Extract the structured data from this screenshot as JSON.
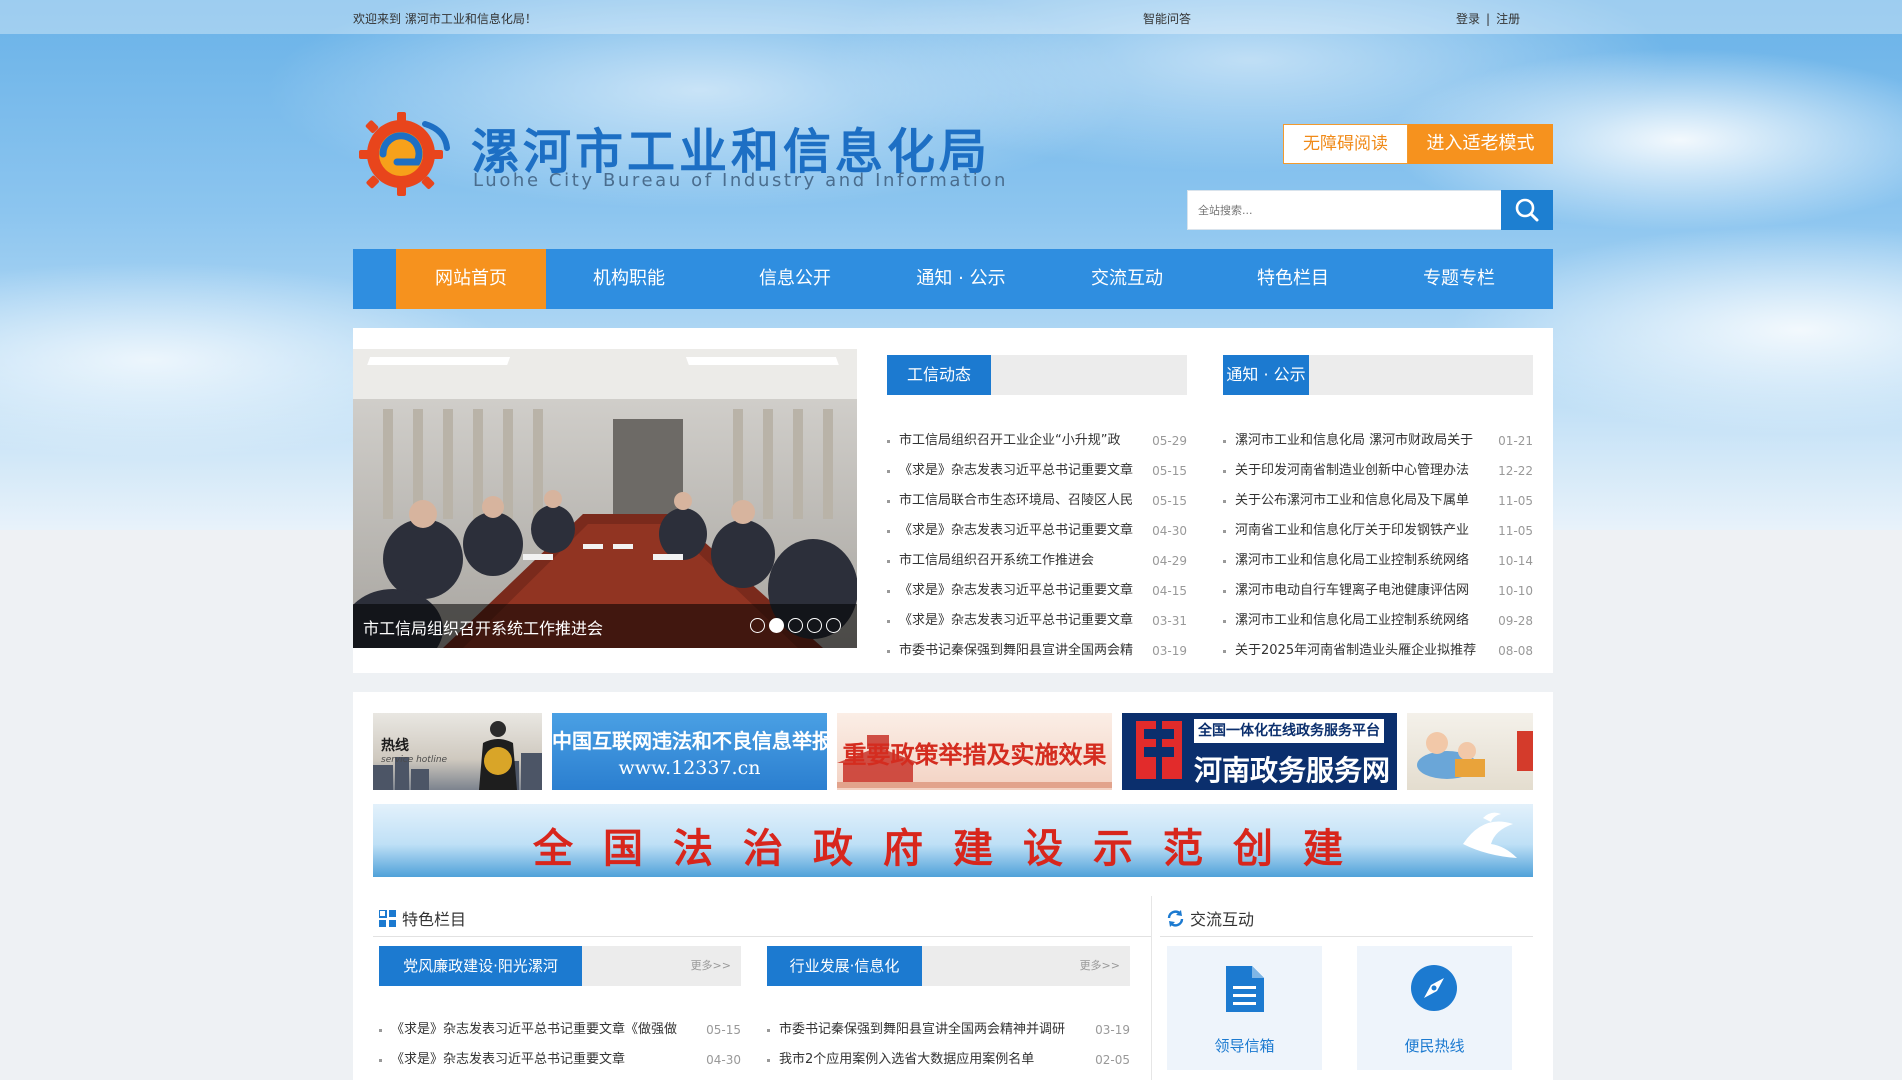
{
  "topbar": {
    "welcome": "欢迎来到 漯河市工业和信息化局！",
    "ai_assistant": "智能问答",
    "login": "登录",
    "separator": "|",
    "register": "注册"
  },
  "logo": {
    "title_cn": "漯河市工业和信息化局",
    "title_en": "Luohe City Bureau of Industry and Information"
  },
  "access": {
    "accessible_reading": "无障碍阅读",
    "elder_mode": "进入适老模式"
  },
  "search": {
    "placeholder": "全站搜索..."
  },
  "nav": {
    "items": [
      "网站首页",
      "机构职能",
      "信息公开",
      "通知 · 公示",
      "交流互动",
      "特色栏目",
      "专题专栏"
    ],
    "active": 0
  },
  "slider": {
    "caption": "市工信局组织召开系统工作推进会",
    "dot_count": 5,
    "active_dot": 1
  },
  "news": {
    "tab": "工信动态",
    "items": [
      {
        "title": "市工信局组织召开工业企业“小升规”政",
        "date": "05-29"
      },
      {
        "title": "《求是》杂志发表习近平总书记重要文章",
        "date": "05-15"
      },
      {
        "title": "市工信局联合市生态环境局、召陵区人民",
        "date": "05-15"
      },
      {
        "title": "《求是》杂志发表习近平总书记重要文章",
        "date": "04-30"
      },
      {
        "title": "市工信局组织召开系统工作推进会",
        "date": "04-29"
      },
      {
        "title": "《求是》杂志发表习近平总书记重要文章",
        "date": "04-15"
      },
      {
        "title": "《求是》杂志发表习近平总书记重要文章",
        "date": "03-31"
      },
      {
        "title": "市委书记秦保强到舞阳县宣讲全国两会精",
        "date": "03-19"
      }
    ]
  },
  "notices": {
    "tab": "通知 · 公示",
    "items": [
      {
        "title": "漯河市工业和信息化局 漯河市财政局关于",
        "date": "01-21"
      },
      {
        "title": "关于印发河南省制造业创新中心管理办法",
        "date": "12-22"
      },
      {
        "title": "关于公布漯河市工业和信息化局及下属单",
        "date": "11-05"
      },
      {
        "title": "河南省工业和信息化厅关于印发钢铁产业",
        "date": "11-05"
      },
      {
        "title": "漯河市工业和信息化局工业控制系统网络",
        "date": "10-14"
      },
      {
        "title": "漯河市电动自行车锂离子电池健康评估网",
        "date": "10-10"
      },
      {
        "title": "漯河市工业和信息化局工业控制系统网络",
        "date": "09-28"
      },
      {
        "title": "关于2025年河南省制造业头雁企业拟推荐",
        "date": "08-08"
      }
    ]
  },
  "banners": {
    "hotline_text": "热线",
    "hotline_sub": "service hotline",
    "report_center": "中国互联网违法和不良信息举报中心",
    "report_url": "www.12337.cn",
    "policy": "重要政策举措及实施效果",
    "gov_platform": "全国一体化在线政务服务平台",
    "henan_service": "河南政务服务网",
    "law_slogan": "全国法治政府建设示范创建"
  },
  "featured": {
    "title": "特色栏目",
    "tab1": "党风廉政建设·阳光漯河",
    "tab2": "行业发展·信息化",
    "more": "更多>>",
    "col1": [
      {
        "title": "《求是》杂志发表习近平总书记重要文章《做强做",
        "date": "05-15"
      },
      {
        "title": "《求是》杂志发表习近平总书记重要文章",
        "date": "04-30"
      }
    ],
    "col2": [
      {
        "title": "市委书记秦保强到舞阳县宣讲全国两会精神并调研",
        "date": "03-19"
      },
      {
        "title": "我市2个应用案例入选省大数据应用案例名单",
        "date": "02-05"
      }
    ]
  },
  "interaction": {
    "title": "交流互动",
    "mailbox": "领导信箱",
    "hotline": "便民热线"
  },
  "colors": {
    "brand_blue": "#1c7ad0",
    "nav_blue": "#2f8ee0",
    "accent_orange": "#f6921e"
  },
  "icons": [
    "gear-e-logo-icon",
    "search-icon",
    "grid-icon",
    "refresh-icon",
    "document-icon",
    "compass-icon"
  ]
}
